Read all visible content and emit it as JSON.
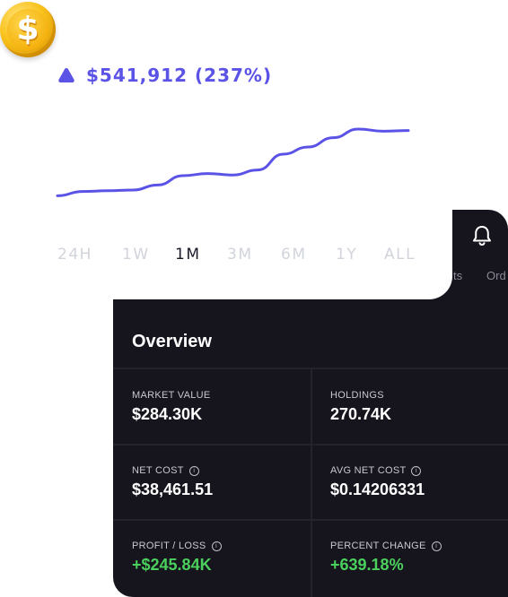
{
  "headline": {
    "value": "$541,912",
    "change_pct": "(237%)",
    "trend_icon": "triangle-up-icon"
  },
  "coin_icon": "dollar-coin-icon",
  "time_ranges": [
    {
      "label": "24H",
      "active": false
    },
    {
      "label": "1W",
      "active": false
    },
    {
      "label": "1M",
      "active": true
    },
    {
      "label": "3M",
      "active": false
    },
    {
      "label": "6M",
      "active": false
    },
    {
      "label": "1Y",
      "active": false
    },
    {
      "label": "ALL",
      "active": false
    }
  ],
  "tabs_peek": [
    "ts",
    "Ord"
  ],
  "overview": {
    "title": "Overview",
    "stats": [
      {
        "label": "MARKET VALUE",
        "value": "$284.30K",
        "info": false,
        "positive": false
      },
      {
        "label": "HOLDINGS",
        "value": "270.74K",
        "info": false,
        "positive": false
      },
      {
        "label": "NET COST",
        "value": "$38,461.51",
        "info": true,
        "positive": false
      },
      {
        "label": "AVG NET COST",
        "value": "$0.14206331",
        "info": true,
        "positive": false
      },
      {
        "label": "PROFIT / LOSS",
        "value": "+$245.84K",
        "info": true,
        "positive": true
      },
      {
        "label": "PERCENT CHANGE",
        "value": "+639.18%",
        "info": true,
        "positive": true
      }
    ]
  },
  "colors": {
    "accent": "#5b53e6",
    "positive": "#4bd05d",
    "card_bg": "#16141c",
    "inactive_range": "#d2d4dc"
  },
  "chart_data": {
    "type": "line",
    "series": [
      {
        "values": [
          12,
          18,
          19,
          20,
          27,
          40,
          43,
          41,
          48,
          70,
          80,
          93,
          105,
          102,
          103
        ]
      }
    ],
    "ylim": [
      0,
      110
    ]
  }
}
